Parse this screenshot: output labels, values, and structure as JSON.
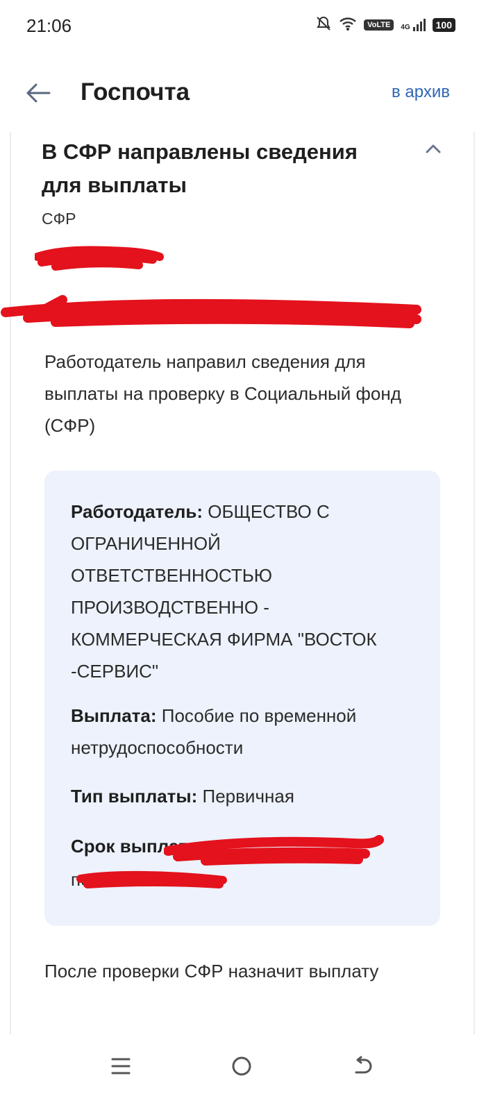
{
  "status_bar": {
    "time": "21:06",
    "volte": "VoLTE",
    "network": "4G",
    "battery": "100"
  },
  "header": {
    "title": "Госпочта",
    "archive_label": "в архив"
  },
  "message": {
    "title": "В СФР направлены сведения для выплаты",
    "sender": "СФР",
    "intro": "Работодатель направил сведения для выплаты на проверку в Социальный фонд (СФР)",
    "details": {
      "employer_label": "Работодатель:",
      "employer_value": "ОБЩЕСТВО С ОГРАНИЧЕННОЙ ОТВЕТСТВЕННОСТЬЮ ПРОИЗВОДСТВЕННО - КОММЕРЧЕСКАЯ ФИРМА \"ВОСТОК -СЕРВИС\"",
      "payment_label": "Выплата:",
      "payment_value": "Пособие по временной нетрудоспособности",
      "type_label": "Тип выплаты:",
      "type_value": "Первичная",
      "term_label": "Срок выплаты:",
      "term_from": "с",
      "term_to": "по"
    },
    "footer": "После проверки СФР назначит выплату"
  },
  "colors": {
    "accent": "#2f66b3",
    "info_box": "#edf2fc",
    "redaction": "#e3121c"
  }
}
